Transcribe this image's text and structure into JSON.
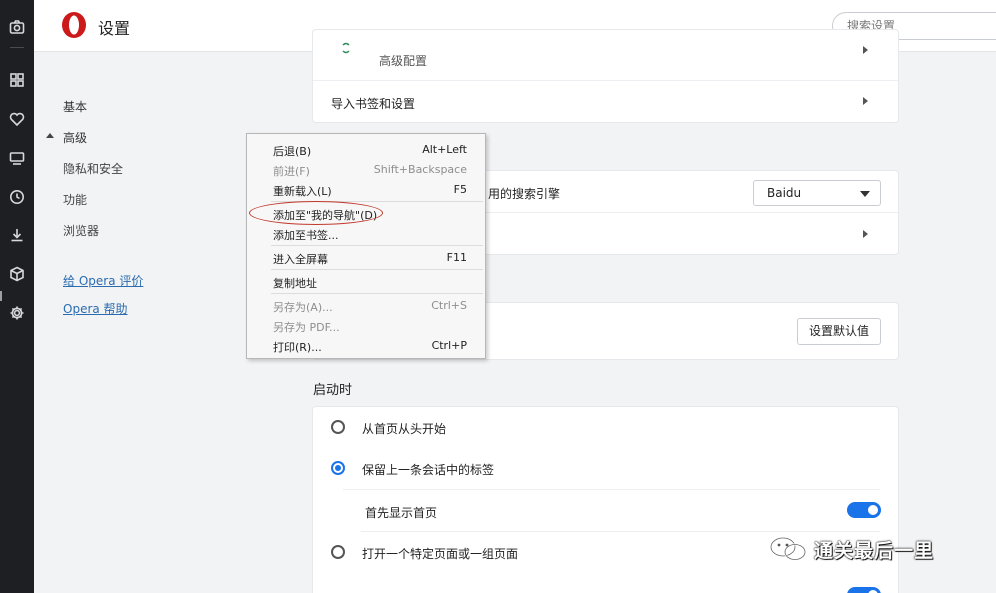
{
  "header": {
    "title": "设置",
    "search_placeholder": "搜索设置"
  },
  "sidebar_icons": [
    "camera-icon",
    "apps-icon",
    "heart-icon",
    "player-icon",
    "history-icon",
    "download-icon",
    "cube-icon",
    "gear-icon"
  ],
  "nav": {
    "items": [
      {
        "label": "基本"
      },
      {
        "label": "高级"
      },
      {
        "label": "隐私和安全"
      },
      {
        "label": "功能"
      },
      {
        "label": "浏览器"
      }
    ],
    "links": [
      {
        "label": "给 Opera 评价"
      },
      {
        "label": "Opera 帮助"
      }
    ]
  },
  "content": {
    "top_card": {
      "row1_label": "高级配置",
      "row2_label": "导入书签和设置"
    },
    "search_card": {
      "row1_label": "用的搜索引擎",
      "engine_value": "Baidu"
    },
    "default_btn": "设置默认值",
    "startup": {
      "title": "启动时",
      "options": [
        {
          "label": "从首页从头开始",
          "selected": false
        },
        {
          "label": "保留上一条会话中的标签",
          "selected": true
        },
        {
          "label": "首先显示首页",
          "toggle": true
        },
        {
          "label": "打开一个特定页面或一组页面",
          "selected": false
        }
      ]
    }
  },
  "context_menu": {
    "items": [
      {
        "label": "后退(B)",
        "shortcut": "Alt+Left",
        "disabled": false
      },
      {
        "label": "前进(F)",
        "shortcut": "Shift+Backspace",
        "disabled": true
      },
      {
        "label": "重新载入(L)",
        "shortcut": "F5",
        "disabled": false
      },
      {
        "label": "添加至\"我的导航\"(D)",
        "shortcut": "",
        "disabled": false
      },
      {
        "label": "添加至书签...",
        "shortcut": "",
        "disabled": false
      },
      {
        "label": "进入全屏幕",
        "shortcut": "F11",
        "disabled": false
      },
      {
        "label": "复制地址",
        "shortcut": "",
        "disabled": false
      },
      {
        "label": "另存为(A)...",
        "shortcut": "Ctrl+S",
        "disabled": true
      },
      {
        "label": "另存为 PDF...",
        "shortcut": "",
        "disabled": true
      },
      {
        "label": "打印(R)...",
        "shortcut": "Ctrl+P",
        "disabled": false
      }
    ]
  },
  "watermark": {
    "text": "通关最后一里"
  },
  "colors": {
    "accent": "#1a73e8",
    "link": "#2b6cb0",
    "annotation": "#c0392b",
    "brand": "#cc1a1a"
  }
}
